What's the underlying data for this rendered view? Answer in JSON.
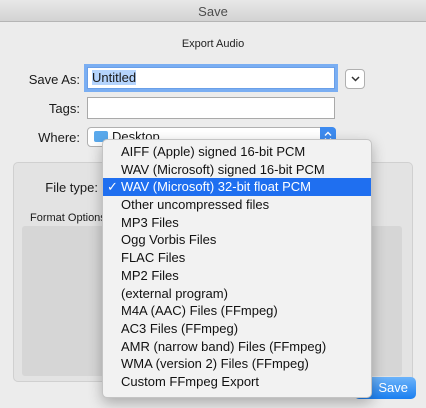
{
  "window": {
    "title": "Save"
  },
  "dialog": {
    "heading": "Export Audio",
    "save_as": {
      "label": "Save As:",
      "value": "Untitled"
    },
    "tags": {
      "label": "Tags:",
      "value": ""
    },
    "where": {
      "label": "Where:",
      "value": "Desktop"
    },
    "file_type": {
      "label": "File type:"
    },
    "format_options": {
      "label": "Format Options"
    },
    "save_label": "Save"
  },
  "file_type_menu": {
    "items": [
      {
        "label": "AIFF (Apple) signed 16-bit PCM"
      },
      {
        "label": "WAV (Microsoft) signed 16-bit PCM"
      },
      {
        "label": "WAV (Microsoft) 32-bit float PCM"
      },
      {
        "label": "Other uncompressed files"
      },
      {
        "label": "MP3 Files"
      },
      {
        "label": "Ogg Vorbis Files"
      },
      {
        "label": "FLAC Files"
      },
      {
        "label": "MP2 Files"
      },
      {
        "label": "(external program)"
      },
      {
        "label": "M4A (AAC) Files (FFmpeg)"
      },
      {
        "label": "AC3 Files (FFmpeg)"
      },
      {
        "label": "AMR (narrow band) Files (FFmpeg)"
      },
      {
        "label": "WMA (version 2) Files (FFmpeg)"
      },
      {
        "label": "Custom FFmpeg Export"
      }
    ],
    "check_mark": "✓"
  },
  "colors": {
    "accent": "#1f6ff0",
    "focus_ring": "#7aaef2"
  }
}
